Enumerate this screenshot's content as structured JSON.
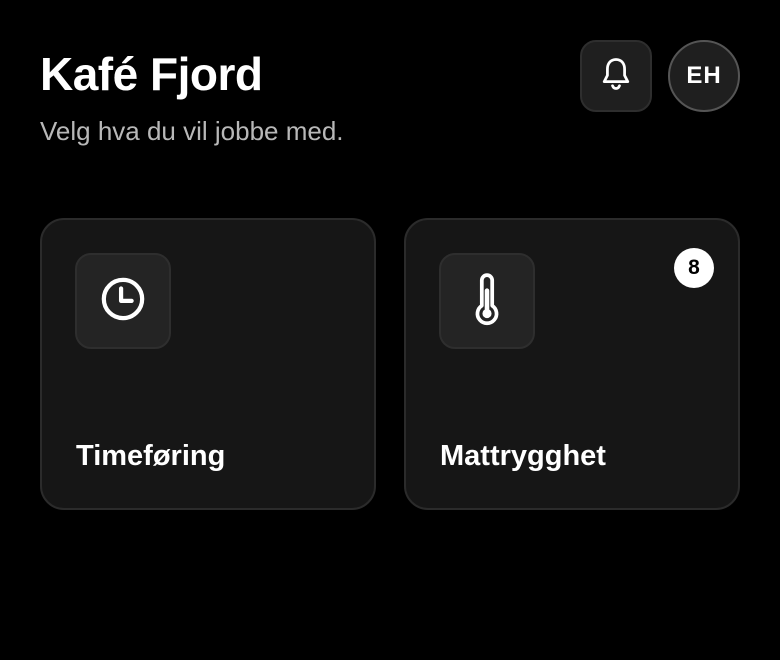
{
  "header": {
    "title": "Kafé Fjord",
    "subtitle": "Velg hva du vil jobbe med."
  },
  "toolbar": {
    "notifications_icon": "bell-icon",
    "avatar_initials": "EH"
  },
  "cards": [
    {
      "label": "Timeføring",
      "icon": "clock-icon"
    },
    {
      "label": "Mattrygghet",
      "icon": "thermometer-icon",
      "badge": "8"
    }
  ],
  "colors": {
    "background": "#000000",
    "card_background": "#161616",
    "icon_box_background": "#242424",
    "text_primary": "#ffffff",
    "text_secondary": "#b8b8b8",
    "badge_background": "#ffffff",
    "badge_text": "#000000"
  }
}
